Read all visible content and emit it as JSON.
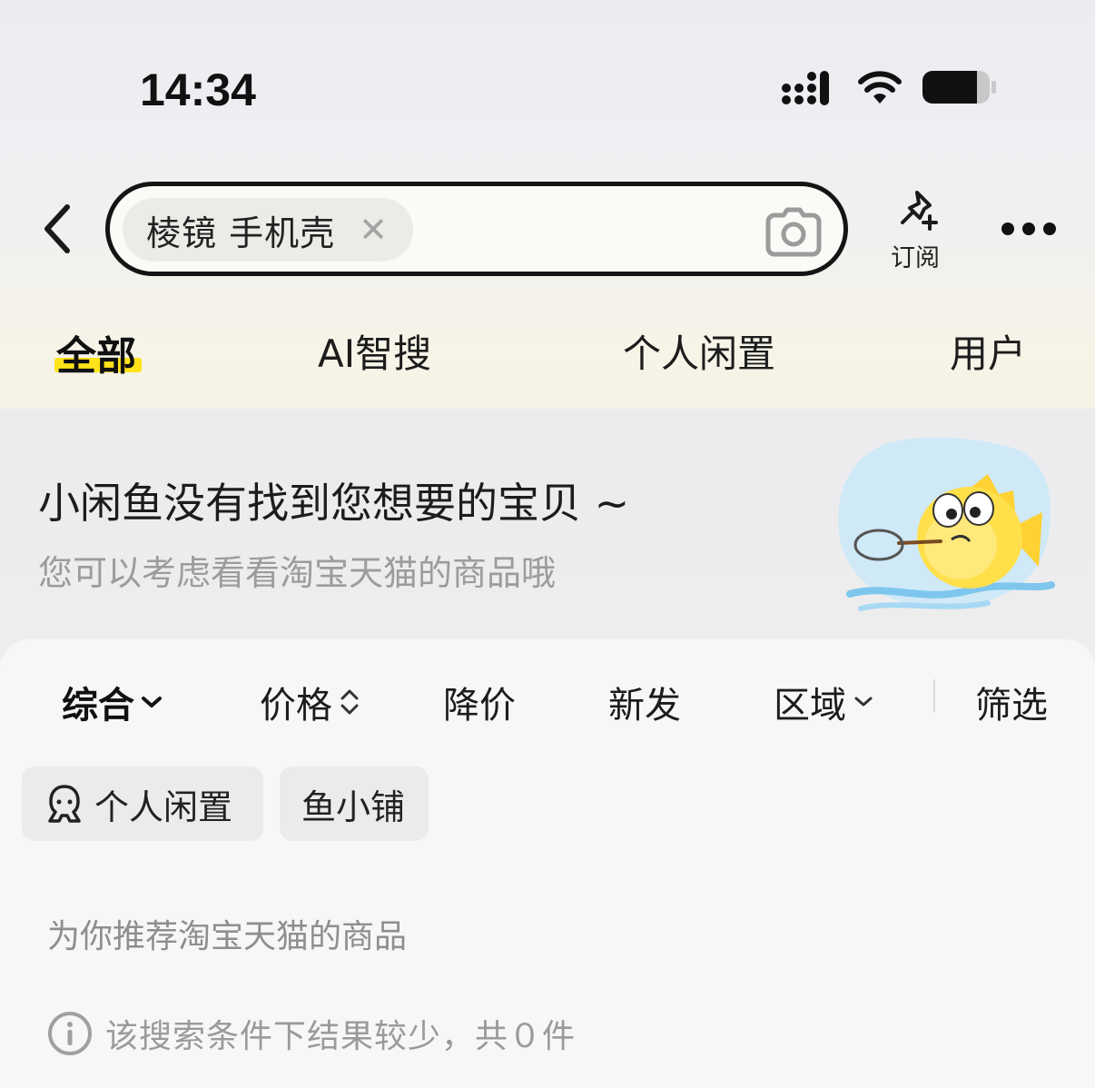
{
  "status_bar": {
    "time": "14:34",
    "icons": [
      "signal-icon",
      "wifi-icon",
      "battery-icon"
    ]
  },
  "header": {
    "back_icon": "chevron-left-icon",
    "search": {
      "chip_text": "棱镜 手机壳",
      "clear_icon": "close-icon",
      "camera_icon": "camera-icon"
    },
    "subscribe": {
      "icon": "pin-plus-icon",
      "label": "订阅"
    },
    "more_icon": "more-icon"
  },
  "tabs": [
    {
      "label": "全部",
      "active": true
    },
    {
      "label": "AI智搜",
      "active": false
    },
    {
      "label": "个人闲置",
      "active": false
    },
    {
      "label": "用户",
      "active": false
    }
  ],
  "empty_state": {
    "title": "小闲鱼没有找到您想要的宝贝 ~",
    "subtitle": "您可以考虑看看淘宝天猫的商品哦"
  },
  "sort_bar": [
    {
      "label": "综合",
      "icon": "chevron-down-icon",
      "active": true
    },
    {
      "label": "价格",
      "icon": "sort-updown-icon",
      "active": false
    },
    {
      "label": "降价",
      "active": false
    },
    {
      "label": "新发",
      "active": false
    },
    {
      "label": "区域",
      "icon": "chevron-down-icon",
      "active": false
    },
    {
      "label": "筛选",
      "active": false
    }
  ],
  "filter_pills": [
    {
      "label": "个人闲置",
      "icon": "person-icon"
    },
    {
      "label": "鱼小铺"
    }
  ],
  "recommend_note": "为你推荐淘宝天猫的商品",
  "result_note": {
    "icon": "info-icon",
    "text": "该搜索条件下结果较少，共０件"
  },
  "colors": {
    "accent_yellow": "#ffe21a",
    "text_primary": "#1c1c1c",
    "text_secondary": "#9c9c9c"
  }
}
